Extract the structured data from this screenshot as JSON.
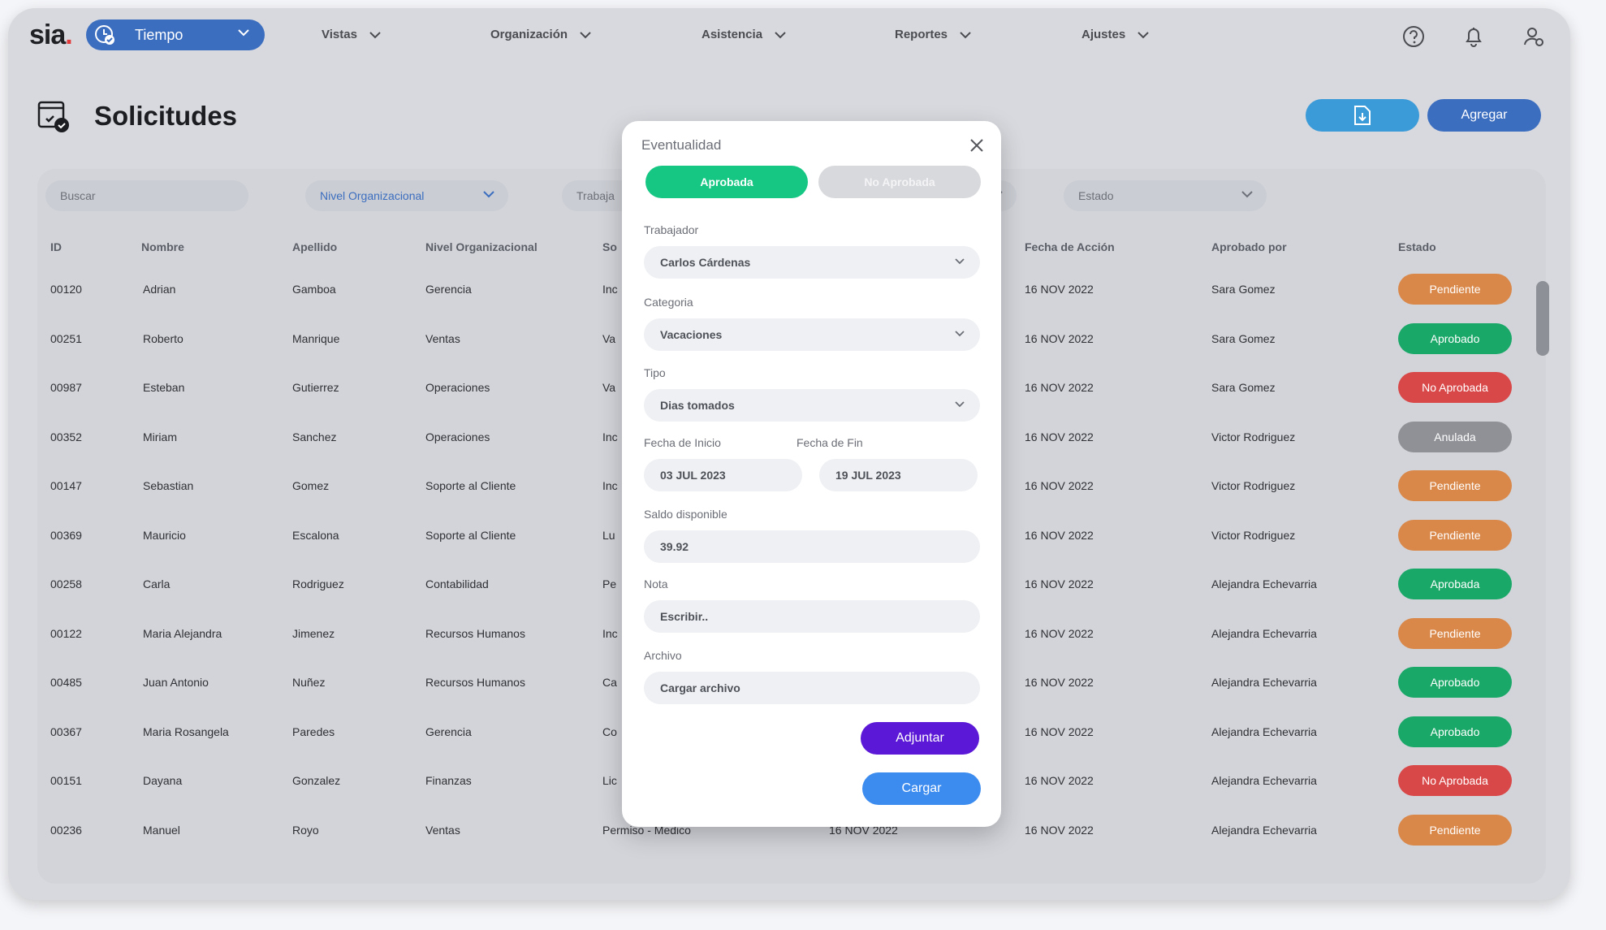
{
  "nav": {
    "logo": "sia",
    "logo_dot": ".",
    "module_label": "Tiempo",
    "menu": [
      "Vistas",
      "Organización",
      "Asistencia",
      "Reportes",
      "Ajustes"
    ],
    "icons": [
      "help-icon",
      "bell-icon",
      "user-settings-icon"
    ]
  },
  "page": {
    "title": "Solicitudes",
    "add_label": "Agregar"
  },
  "filters": {
    "search_placeholder": "Buscar",
    "nivel": "Nivel Organizacional",
    "trabajador": "Trabaja",
    "estado": "Estado"
  },
  "table": {
    "columns": [
      "ID",
      "Nombre",
      "Apellido",
      "Nivel Organizacional",
      "So",
      "Fecha de Acción",
      "Aprobado por",
      "Estado"
    ],
    "rows": [
      {
        "id": "00120",
        "nombre": "Adrian",
        "apellido": "Gamboa",
        "nivel": "Gerencia",
        "sol": "Inc",
        "fecha_sol": "",
        "fecha": "16 NOV 2022",
        "aprobado": "Sara Gomez",
        "estado": "Pendiente",
        "color": "#d9884a"
      },
      {
        "id": "00251",
        "nombre": "Roberto",
        "apellido": "Manrique",
        "nivel": "Ventas",
        "sol": "Va",
        "fecha_sol": "",
        "fecha": "16 NOV 2022",
        "aprobado": "Sara Gomez",
        "estado": "Aprobado",
        "color": "#1aa868"
      },
      {
        "id": "00987",
        "nombre": "Esteban",
        "apellido": "Gutierrez",
        "nivel": "Operaciones",
        "sol": "Va",
        "fecha_sol": "",
        "fecha": "16 NOV 2022",
        "aprobado": "Sara Gomez",
        "estado": "No Aprobada",
        "color": "#d94848"
      },
      {
        "id": "00352",
        "nombre": "Miriam",
        "apellido": "Sanchez",
        "nivel": "Operaciones",
        "sol": "Inc",
        "fecha_sol": "",
        "fecha": "16 NOV 2022",
        "aprobado": "Victor Rodriguez",
        "estado": "Anulada",
        "color": "#8f9197"
      },
      {
        "id": "00147",
        "nombre": "Sebastian",
        "apellido": "Gomez",
        "nivel": "Soporte al Cliente",
        "sol": "Inc",
        "fecha_sol": "",
        "fecha": "16 NOV 2022",
        "aprobado": "Victor Rodriguez",
        "estado": "Pendiente",
        "color": "#d9884a"
      },
      {
        "id": "00369",
        "nombre": "Mauricio",
        "apellido": "Escalona",
        "nivel": "Soporte al Cliente",
        "sol": "Lu",
        "fecha_sol": "",
        "fecha": "16 NOV 2022",
        "aprobado": "Victor Rodriguez",
        "estado": "Pendiente",
        "color": "#d9884a"
      },
      {
        "id": "00258",
        "nombre": "Carla",
        "apellido": "Rodriguez",
        "nivel": "Contabilidad",
        "sol": "Pe",
        "fecha_sol": "",
        "fecha": "16 NOV 2022",
        "aprobado": "Alejandra Echevarria",
        "estado": "Aprobada",
        "color": "#1aa868"
      },
      {
        "id": "00122",
        "nombre": "Maria Alejandra",
        "apellido": "Jimenez",
        "nivel": "Recursos Humanos",
        "sol": "Inc",
        "fecha_sol": "",
        "fecha": "16 NOV 2022",
        "aprobado": "Alejandra Echevarria",
        "estado": "Pendiente",
        "color": "#d9884a"
      },
      {
        "id": "00485",
        "nombre": "Juan Antonio",
        "apellido": "Nuñez",
        "nivel": "Recursos Humanos",
        "sol": "Ca",
        "fecha_sol": "",
        "fecha": "16 NOV 2022",
        "aprobado": "Alejandra Echevarria",
        "estado": "Aprobado",
        "color": "#1aa868"
      },
      {
        "id": "00367",
        "nombre": "Maria Rosangela",
        "apellido": "Paredes",
        "nivel": "Gerencia",
        "sol": "Co",
        "fecha_sol": "",
        "fecha": "16 NOV 2022",
        "aprobado": "Alejandra Echevarria",
        "estado": "Aprobado",
        "color": "#1aa868"
      },
      {
        "id": "00151",
        "nombre": "Dayana",
        "apellido": "Gonzalez",
        "nivel": "Finanzas",
        "sol": "Lic",
        "fecha_sol": "",
        "fecha": "16 NOV 2022",
        "aprobado": "Alejandra Echevarria",
        "estado": "No Aprobada",
        "color": "#d94848"
      },
      {
        "id": "00236",
        "nombre": "Manuel",
        "apellido": "Royo",
        "nivel": "Ventas",
        "sol": "Permiso - Medico",
        "fecha_sol": "16 NOV 2022",
        "fecha": "16 NOV 2022",
        "aprobado": "Alejandra Echevarria",
        "estado": "Pendiente",
        "color": "#d9884a"
      }
    ]
  },
  "modal": {
    "title": "Eventualidad",
    "seg_aprobada": "Aprobada",
    "seg_no_aprobada": "No Aprobada",
    "trabajador_label": "Trabajador",
    "trabajador_value": "Carlos Cárdenas",
    "categoria_label": "Categoria",
    "categoria_value": "Vacaciones",
    "tipo_label": "Tipo",
    "tipo_value": "Dias tomados",
    "inicio_label": "Fecha de Inicio",
    "inicio_value": "03 JUL 2023",
    "fin_label": "Fecha de Fin",
    "fin_value": "19 JUL 2023",
    "saldo_label": "Saldo disponible",
    "saldo_value": "39.92",
    "nota_label": "Nota",
    "nota_placeholder": "Escribir..",
    "archivo_label": "Archivo",
    "archivo_placeholder": "Cargar archivo",
    "adjuntar": "Adjuntar",
    "cargar": "Cargar"
  },
  "colors": {
    "accent": "#3c6ec0",
    "approved": "#1aa868",
    "pending": "#d9884a",
    "rejected": "#d94848",
    "cancelled": "#8f9197",
    "modal_green": "#16c784",
    "purple": "#5b18d6"
  }
}
